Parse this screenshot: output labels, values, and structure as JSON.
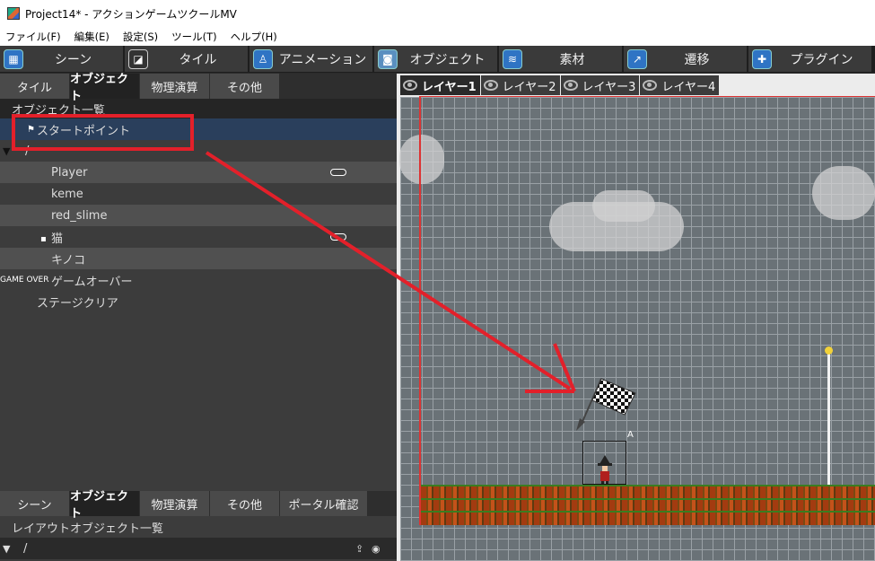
{
  "window": {
    "title": "Project14* - アクションゲームツクールMV"
  },
  "menu": [
    "ファイル(F)",
    "編集(E)",
    "設定(S)",
    "ツール(T)",
    "ヘルプ(H)"
  ],
  "main_tabs": [
    {
      "label": "シーン",
      "icon": "scene-icon"
    },
    {
      "label": "タイル",
      "icon": "tile-icon"
    },
    {
      "label": "アニメーション",
      "icon": "animation-icon"
    },
    {
      "label": "オブジェクト",
      "icon": "object-icon"
    },
    {
      "label": "素材",
      "icon": "material-icon"
    },
    {
      "label": "遷移",
      "icon": "transition-icon"
    },
    {
      "label": "プラグイン",
      "icon": "plugin-icon"
    }
  ],
  "upper_subtabs": [
    "タイル",
    "オブジェクト",
    "物理演算",
    "その他"
  ],
  "object_list": {
    "header": "オブジェクト一覧",
    "start_point": "スタートポイント",
    "folder": "/",
    "items": [
      "Player",
      "keme",
      "red_slime",
      "猫",
      "キノコ"
    ],
    "game_over_badge": "GAME OVER",
    "game_over": "ゲームオーバー",
    "stage_clear": "ステージクリア"
  },
  "lower_subtabs": [
    "シーン",
    "オブジェクト",
    "物理演算",
    "その他",
    "ポータル確認"
  ],
  "layout_list": {
    "header": "レイアウトオブジェクト一覧",
    "folder": "/"
  },
  "layers": [
    "レイヤー1",
    "レイヤー2",
    "レイヤー3",
    "レイヤー4"
  ],
  "canvas": {
    "object_tag": "A"
  },
  "colors": {
    "annotation": "#e3202a",
    "selection": "#2a3f5c",
    "grid": "#6a7277"
  }
}
